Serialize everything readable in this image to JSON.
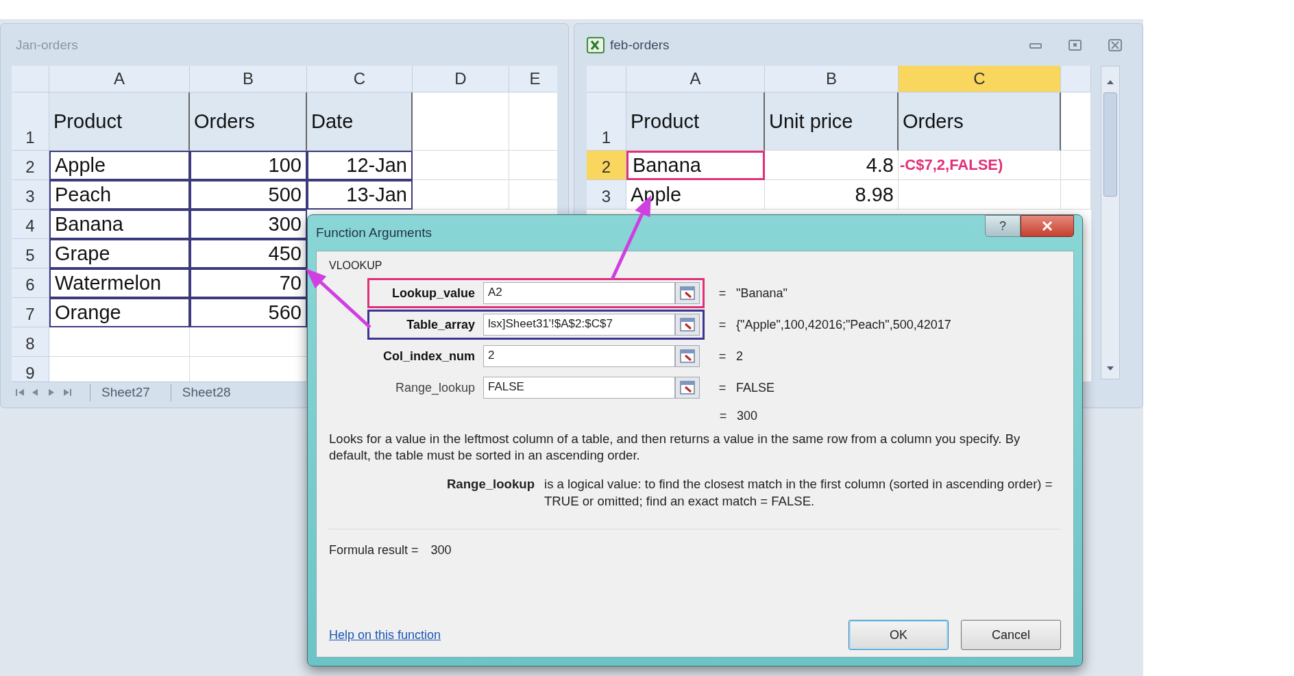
{
  "jan_window": {
    "title": "Jan-orders",
    "columns": [
      "A",
      "B",
      "C",
      "D",
      "E"
    ],
    "rows": [
      {
        "number": "1",
        "header": true,
        "cells": [
          "Product",
          "Orders",
          "Date"
        ]
      },
      {
        "number": "2",
        "header": false,
        "framed": true,
        "cells": [
          "Apple",
          "100",
          "12-Jan"
        ]
      },
      {
        "number": "3",
        "header": false,
        "framed": true,
        "cells": [
          "Peach",
          "500",
          "13-Jan"
        ]
      },
      {
        "number": "4",
        "header": false,
        "framed": true,
        "cells": [
          "Banana",
          "300"
        ]
      },
      {
        "number": "5",
        "header": false,
        "framed": true,
        "cells": [
          "Grape",
          "450"
        ]
      },
      {
        "number": "6",
        "header": false,
        "framed": true,
        "cells": [
          "Watermelon",
          "70"
        ]
      },
      {
        "number": "7",
        "header": false,
        "framed": true,
        "cells": [
          "Orange",
          "560"
        ]
      },
      {
        "number": "8",
        "header": false
      },
      {
        "number": "9",
        "header": false
      }
    ],
    "tabs": [
      "Sheet27",
      "Sheet28"
    ]
  },
  "feb_window": {
    "title": "feb-orders",
    "columns": [
      {
        "label": "A",
        "selected": false
      },
      {
        "label": "B",
        "selected": false
      },
      {
        "label": "C",
        "selected": true
      }
    ],
    "rows": [
      {
        "number": "1",
        "selected": false,
        "header": true,
        "cells": [
          {
            "text": "Product",
            "framed": false,
            "editing": false
          },
          {
            "text": "Unit price",
            "framed": false,
            "editing": false
          },
          {
            "text": "Orders",
            "framed": false,
            "editing": false
          }
        ]
      },
      {
        "number": "2",
        "selected": true,
        "header": false,
        "cells": [
          {
            "text": "Banana",
            "framed": true,
            "editing": false
          },
          {
            "text": "4.8",
            "framed": false,
            "editing": false
          },
          {
            "text": "-C$7,2,FALSE)",
            "framed": false,
            "editing": true
          }
        ]
      },
      {
        "number": "3",
        "selected": false,
        "header": false,
        "cells": [
          {
            "text": "Apple",
            "framed": false,
            "editing": false
          },
          {
            "text": "8.98",
            "framed": false,
            "editing": false
          }
        ]
      }
    ]
  },
  "dialog": {
    "title": "Function Arguments",
    "help_button": "?",
    "function": "VLOOKUP",
    "arguments": [
      {
        "label": "Lookup_value",
        "required": true,
        "value": "A2",
        "color": "#e0307a",
        "sign": "=",
        "result": "\"Banana\""
      },
      {
        "label": "Table_array",
        "required": true,
        "value": "lsx]Sheet31'!$A$2:$C$7",
        "color": "#3c3490",
        "sign": "=",
        "result": "{\"Apple\",100,42016;\"Peach\",500,42017"
      },
      {
        "label": "Col_index_num",
        "required": true,
        "value": "2",
        "sign": "=",
        "result": "2"
      },
      {
        "label": "Range_lookup",
        "required": false,
        "value": "FALSE",
        "sign": "=",
        "result": "FALSE"
      }
    ],
    "total": {
      "sign": "=",
      "value": "300"
    },
    "description": "Looks for a value in the leftmost column of a table, and then returns a value in the same row from a column you specify. By default, the table must be sorted in an ascending order.",
    "parameter": {
      "name": "Range_lookup",
      "text": "is a logical value: to find the closest match in the first column (sorted in ascending order) = TRUE or omitted; find an exact match = FALSE."
    },
    "formula_result": {
      "label": "Formula result =",
      "value": "300"
    },
    "help_link": "Help on this function",
    "buttons": [
      {
        "label": "OK",
        "default": true
      },
      {
        "label": "Cancel",
        "default": false
      }
    ]
  }
}
